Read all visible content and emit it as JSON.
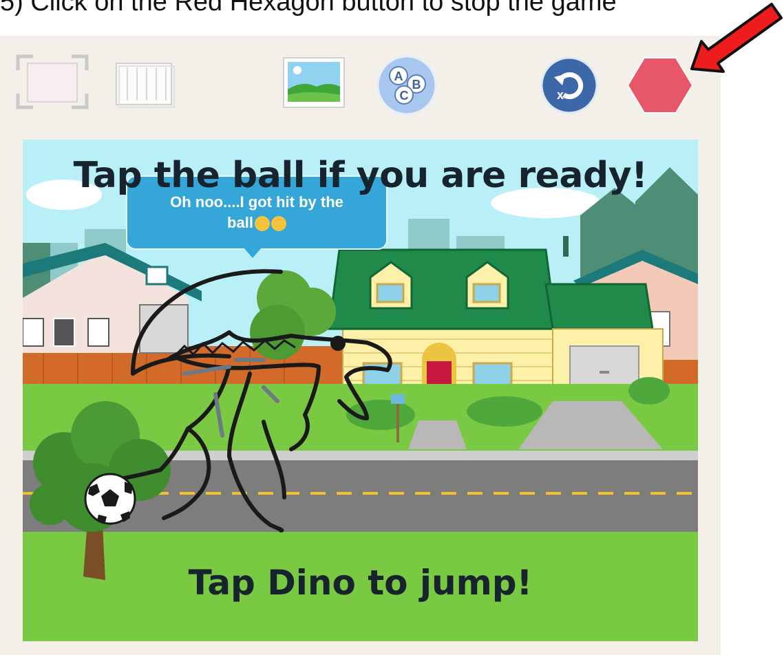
{
  "instruction": "5) Click on the Red Hexagon button to stop the game",
  "toolbar": {
    "fullscreen_icon": "fullscreen-icon",
    "grid_icon": "grid-icon",
    "background_icon": "background-image-icon",
    "abc_icon": "abc-icon",
    "abc_letters": [
      "A",
      "B",
      "C"
    ],
    "reset_icon": "reset-icon",
    "reset_letter": "x",
    "stop_icon": "red-hexagon-stop-icon"
  },
  "stage": {
    "title": "Tap the ball if you are ready!",
    "speech_line1": "Oh noo....I got hit by the",
    "speech_line2": "ball",
    "bottom_text": "Tap Dino to jump!"
  },
  "colors": {
    "stop": "#e8566a",
    "arrow": "#ee1c1c",
    "grass": "#7ac943",
    "road": "#7d7d7d",
    "sky": "#b9f0f8",
    "house_roof": "#1f8a4a"
  }
}
